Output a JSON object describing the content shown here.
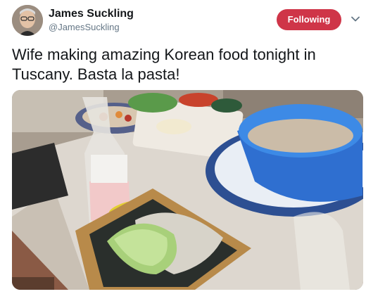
{
  "author": {
    "name": "James Suckling",
    "handle": "@JamesSuckling"
  },
  "follow_button": {
    "label": "Following",
    "color": "#cf3548"
  },
  "menu": {
    "icon": "chevron-down-icon"
  },
  "tweet": {
    "text": "Wife making amazing Korean food tonight in Tuscany. Basta la pasta!"
  },
  "colors": {
    "name_text": "#14171a",
    "handle_text": "#657786"
  }
}
